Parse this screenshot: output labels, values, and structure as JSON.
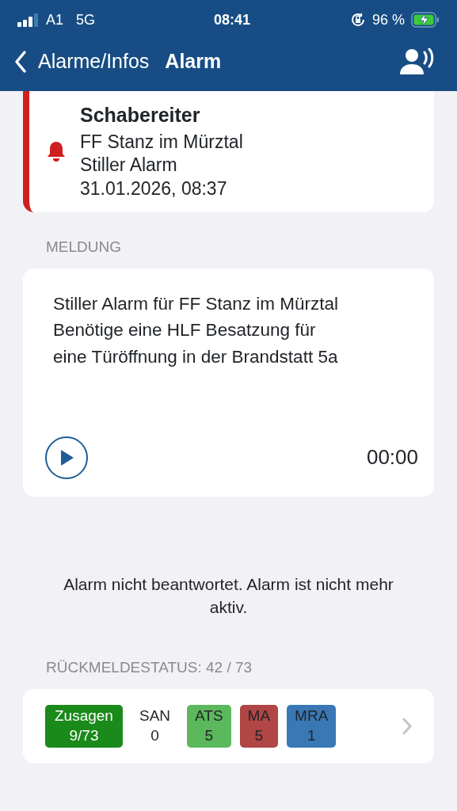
{
  "status_bar": {
    "carrier": "A1",
    "network": "5G",
    "time": "08:41",
    "battery": "96 %",
    "charging": true
  },
  "nav": {
    "back": "Alarme/Infos",
    "title": "Alarm"
  },
  "alarm": {
    "title": "Schabereiter",
    "lines": [
      "FF Stanz im Mürztal",
      "Stiller Alarm",
      "31.01.2026, 08:37"
    ],
    "color": "#d01f1f"
  },
  "message_header": "MELDUNG",
  "message": {
    "lines": [
      "Stiller Alarm für FF Stanz im Mürztal",
      "Benötige eine HLF Besatzung für",
      "eine Türöffnung in der Brandstatt 5a"
    ],
    "duration": "00:00"
  },
  "notice": "Alarm nicht beantwortet. Alarm ist nicht mehr aktiv.",
  "response_header": "RÜCKMELDESTATUS: 42 / 73",
  "responses": [
    {
      "label": "Zusagen",
      "value": "9/73",
      "color": "#1a8a1a"
    },
    {
      "label": "SAN",
      "value": "0"
    },
    {
      "label": "ATS",
      "value": "5",
      "color": "#5cb85c"
    },
    {
      "label": "MA",
      "value": "5",
      "color": "#b04646"
    },
    {
      "label": "MRA",
      "value": "1",
      "color": "#3a78b5"
    }
  ]
}
